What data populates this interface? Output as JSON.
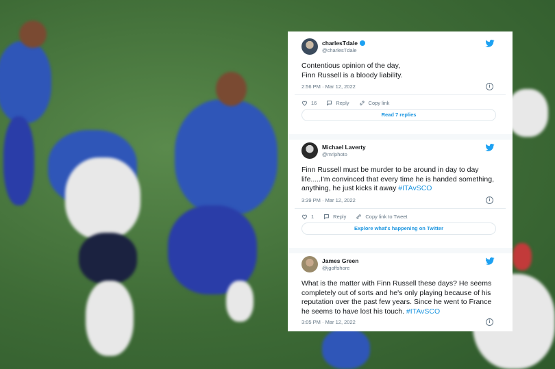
{
  "tweets": [
    {
      "name": "charlesTdale",
      "handle": "@charlesTdale",
      "verified": true,
      "text": "Contentious opinion of the day,\nFinn Russell is a bloody liability.",
      "hashtag": "",
      "timestamp": "2:56 PM · Mar 12, 2022",
      "likes": "16",
      "reply_label": "Reply",
      "copy_label": "Copy link",
      "footer_button": "Read 7 replies"
    },
    {
      "name": "Michael Laverty",
      "handle": "@mrlphoto",
      "verified": false,
      "text": "Finn Russell must be murder to be around in day to day life.....I'm convinced that every time he is handed something, anything, he just kicks it away ",
      "hashtag": "#ITAvSCO",
      "timestamp": "3:39 PM · Mar 12, 2022",
      "likes": "1",
      "reply_label": "Reply",
      "copy_label": "Copy link to Tweet",
      "footer_button": "Explore what's happening on Twitter"
    },
    {
      "name": "James Green",
      "handle": "@jgoffshore",
      "verified": false,
      "text": "What is the matter with Finn Russell these days? He seems completely out of sorts and he's only playing because of his reputation over the past few years. Since he went to France he seems to have lost his touch. ",
      "hashtag": "#ITAvSCO",
      "timestamp": "3:05 PM · Mar 12, 2022"
    }
  ],
  "icons": {
    "twitter": "twitter-bird-icon",
    "info": "info-icon",
    "like": "heart-icon",
    "reply": "reply-icon",
    "copy": "link-icon",
    "verified": "verified-badge-icon"
  },
  "colors": {
    "twitter_blue": "#1da1f2",
    "link_blue": "#1b95e0",
    "muted": "#657786",
    "text": "#14171a"
  }
}
